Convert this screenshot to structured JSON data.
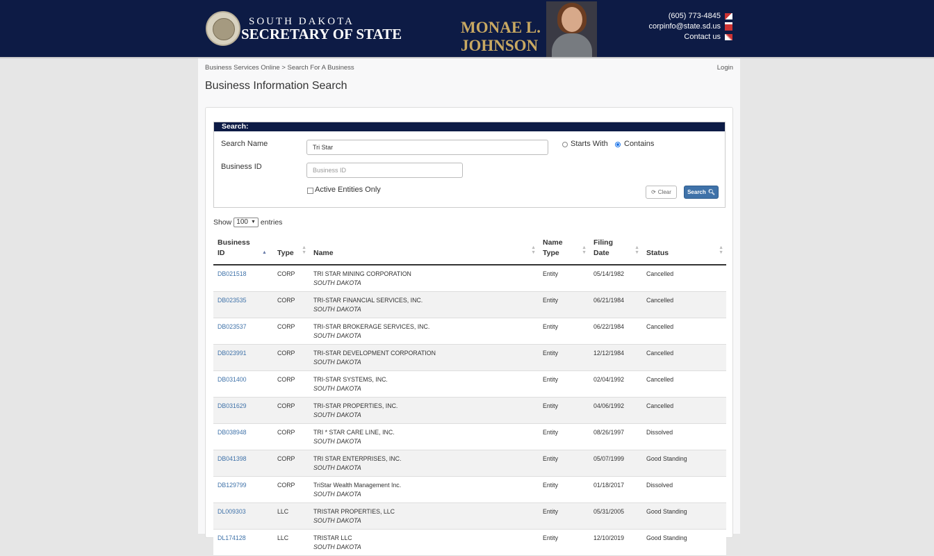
{
  "header": {
    "line1": "SOUTH DAKOTA",
    "line2": "SECRETARY OF STATE",
    "official_first": "MONAE L.",
    "official_last": "JOHNSON",
    "phone": "(605) 773-4845",
    "email": "corpinfo@state.sd.us",
    "contact_label": "Contact us"
  },
  "breadcrumb": {
    "home": "Business Services Online",
    "separator": " > ",
    "current": "Search For A Business"
  },
  "login_label": "Login",
  "page_title": "Business Information Search",
  "search": {
    "heading": "Search:",
    "name_label": "Search Name",
    "name_value": "Tri Star",
    "id_label": "Business ID",
    "id_placeholder": "Business ID",
    "starts_with_label": "Starts With",
    "contains_label": "Contains",
    "selected_mode": "Contains",
    "active_only_label": "Active Entities Only",
    "clear_label": "Clear",
    "search_label": "Search"
  },
  "length": {
    "show_label": "Show",
    "value": "100",
    "entries_label": "entries"
  },
  "table": {
    "columns": [
      {
        "line1": "Business",
        "line2": "ID"
      },
      {
        "line1": "",
        "line2": "Type"
      },
      {
        "line1": "",
        "line2": "Name"
      },
      {
        "line1": "Name",
        "line2": "Type"
      },
      {
        "line1": "Filing",
        "line2": "Date"
      },
      {
        "line1": "",
        "line2": "Status"
      }
    ],
    "rows": [
      {
        "id": "DB021518",
        "type": "CORP",
        "name": "TRI STAR MINING CORPORATION",
        "state": "SOUTH DAKOTA",
        "name_type": "Entity",
        "date": "05/14/1982",
        "status": "Cancelled"
      },
      {
        "id": "DB023535",
        "type": "CORP",
        "name": "TRI-STAR FINANCIAL SERVICES, INC.",
        "state": "SOUTH DAKOTA",
        "name_type": "Entity",
        "date": "06/21/1984",
        "status": "Cancelled"
      },
      {
        "id": "DB023537",
        "type": "CORP",
        "name": "TRI-STAR BROKERAGE SERVICES, INC.",
        "state": "SOUTH DAKOTA",
        "name_type": "Entity",
        "date": "06/22/1984",
        "status": "Cancelled"
      },
      {
        "id": "DB023991",
        "type": "CORP",
        "name": "TRI-STAR DEVELOPMENT CORPORATION",
        "state": "SOUTH DAKOTA",
        "name_type": "Entity",
        "date": "12/12/1984",
        "status": "Cancelled"
      },
      {
        "id": "DB031400",
        "type": "CORP",
        "name": "TRI-STAR SYSTEMS, INC.",
        "state": "SOUTH DAKOTA",
        "name_type": "Entity",
        "date": "02/04/1992",
        "status": "Cancelled"
      },
      {
        "id": "DB031629",
        "type": "CORP",
        "name": "TRI-STAR PROPERTIES, INC.",
        "state": "SOUTH DAKOTA",
        "name_type": "Entity",
        "date": "04/06/1992",
        "status": "Cancelled"
      },
      {
        "id": "DB038948",
        "type": "CORP",
        "name": "TRI * STAR CARE LINE, INC.",
        "state": "SOUTH DAKOTA",
        "name_type": "Entity",
        "date": "08/26/1997",
        "status": "Dissolved"
      },
      {
        "id": "DB041398",
        "type": "CORP",
        "name": "TRI STAR ENTERPRISES, INC.",
        "state": "SOUTH DAKOTA",
        "name_type": "Entity",
        "date": "05/07/1999",
        "status": "Good Standing"
      },
      {
        "id": "DB129799",
        "type": "CORP",
        "name": "TriStar Wealth Management Inc.",
        "state": "SOUTH DAKOTA",
        "name_type": "Entity",
        "date": "01/18/2017",
        "status": "Dissolved"
      },
      {
        "id": "DL009303",
        "type": "LLC",
        "name": "TRISTAR PROPERTIES, LLC",
        "state": "SOUTH DAKOTA",
        "name_type": "Entity",
        "date": "05/31/2005",
        "status": "Good Standing"
      },
      {
        "id": "DL174128",
        "type": "LLC",
        "name": "TRISTAR LLC",
        "state": "SOUTH DAKOTA",
        "name_type": "Entity",
        "date": "12/10/2019",
        "status": "Good Standing"
      }
    ]
  }
}
